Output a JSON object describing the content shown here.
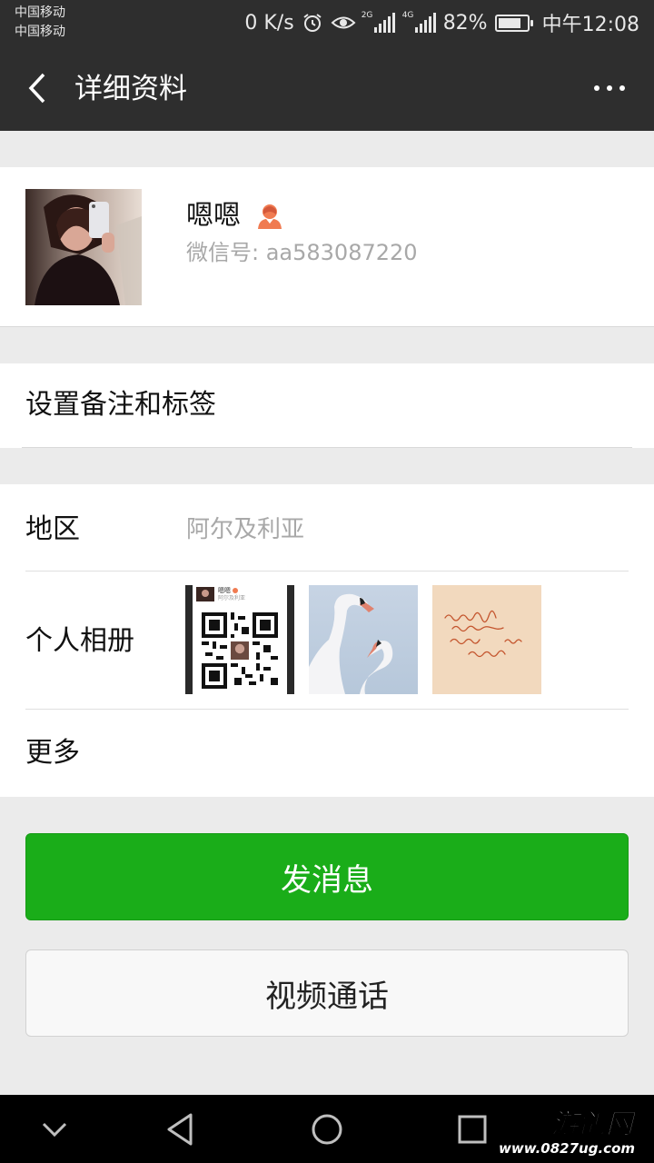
{
  "status_bar": {
    "carrier_1": "中国移动",
    "carrier_2": "中国移动",
    "net_speed": "0 K/s",
    "signal_1_tag": "2G",
    "signal_2_tag": "4G",
    "battery_percent": "82%",
    "battery_level": 0.82,
    "time": "中午12:08",
    "icons": [
      "alarm-icon",
      "eye-icon",
      "signal-icon",
      "battery-icon"
    ]
  },
  "title_bar": {
    "title": "详细资料",
    "back_icon": "chevron-left-icon",
    "more_icon": "more-dots-icon"
  },
  "profile": {
    "nickname": "嗯嗯",
    "wechat_id": "微信号: aa583087220",
    "gender_icon": "female-user-icon",
    "gender_color": "#f07b51"
  },
  "remark": {
    "label": "设置备注和标签"
  },
  "info": {
    "region_label": "地区",
    "region_value": "阿尔及利亚",
    "album_label": "个人相册",
    "more_label": "更多",
    "album_photos": [
      "qr-code-photo",
      "swans-photo",
      "handwriting-photo"
    ]
  },
  "qr_photo": {
    "name": "嗯嗯",
    "region": "阿尔及利亚"
  },
  "actions": {
    "send_message": "发消息",
    "video_call": "视频通话",
    "primary_color": "#1aad19"
  },
  "nav_bar": {
    "icons": [
      "chevron-down-icon",
      "back-triangle-icon",
      "home-circle-icon",
      "recents-square-icon"
    ]
  },
  "watermark": {
    "name": "游鸽网",
    "url": "www.0827ug.com"
  }
}
